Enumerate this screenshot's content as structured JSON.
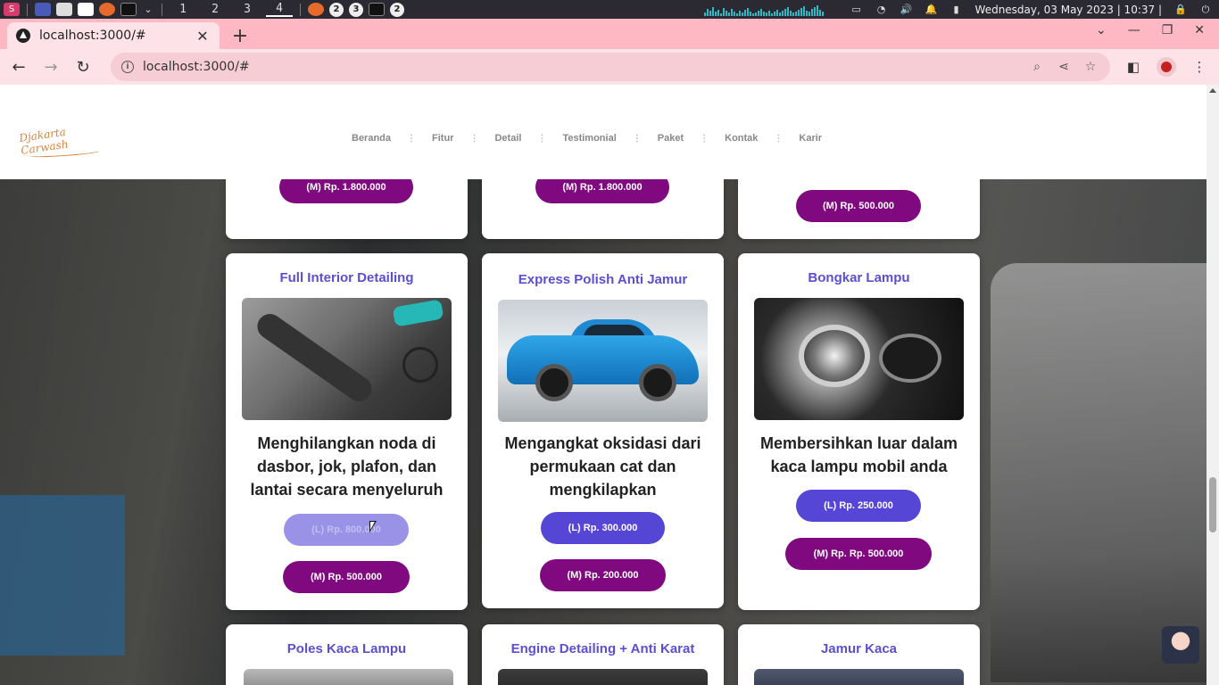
{
  "taskbar": {
    "workspaces": [
      "1",
      "2",
      "3",
      "4"
    ],
    "active_workspace": "4",
    "badges": [
      "2",
      "3",
      "2"
    ],
    "datetime": "Wednesday, 03 May 2023 | 10:37 |"
  },
  "browser": {
    "tab_title": "localhost:3000/#",
    "url": "localhost:3000/#",
    "new_tab_label": "+"
  },
  "site": {
    "logo_text": "Djakarta Carwash",
    "nav": [
      "Beranda",
      "Fitur",
      "Detail",
      "Testimonial",
      "Paket",
      "Kontak",
      "Karir"
    ]
  },
  "top_row": [
    {
      "button": "(M) Rp. 1.800.000"
    },
    {
      "button": "(M) Rp. 1.800.000"
    },
    {
      "button": "(M) Rp. 500.000"
    }
  ],
  "cards": [
    {
      "title": "Full Interior Detailing",
      "description": "Menghilangkan noda di dasbor, jok, plafon, dan lantai secara menyeluruh",
      "price_l": "(L) Rp. 800.000",
      "price_m": "(M) Rp. 500.000"
    },
    {
      "title": "Express Polish Anti Jamur",
      "description": "Mengangkat oksidasi dari permukaan cat dan mengkilapkan",
      "price_l": "(L) Rp. 300.000",
      "price_m": "(M) Rp. 200.000"
    },
    {
      "title": "Bongkar Lampu",
      "description": "Membersihkan luar dalam kaca lampu mobil anda",
      "price_l": "(L) Rp. 250.000",
      "price_m": "(M) Rp. Rp. 500.000"
    }
  ],
  "bottom_row": [
    {
      "title": "Poles Kaca Lampu"
    },
    {
      "title": "Engine Detailing + Anti Karat"
    },
    {
      "title": "Jamur Kaca"
    }
  ],
  "colors": {
    "accent_purple": "#5546d6",
    "accent_magenta": "#80097f",
    "title_color": "#5a4fcf",
    "tab_bar": "#fdb8c4"
  }
}
